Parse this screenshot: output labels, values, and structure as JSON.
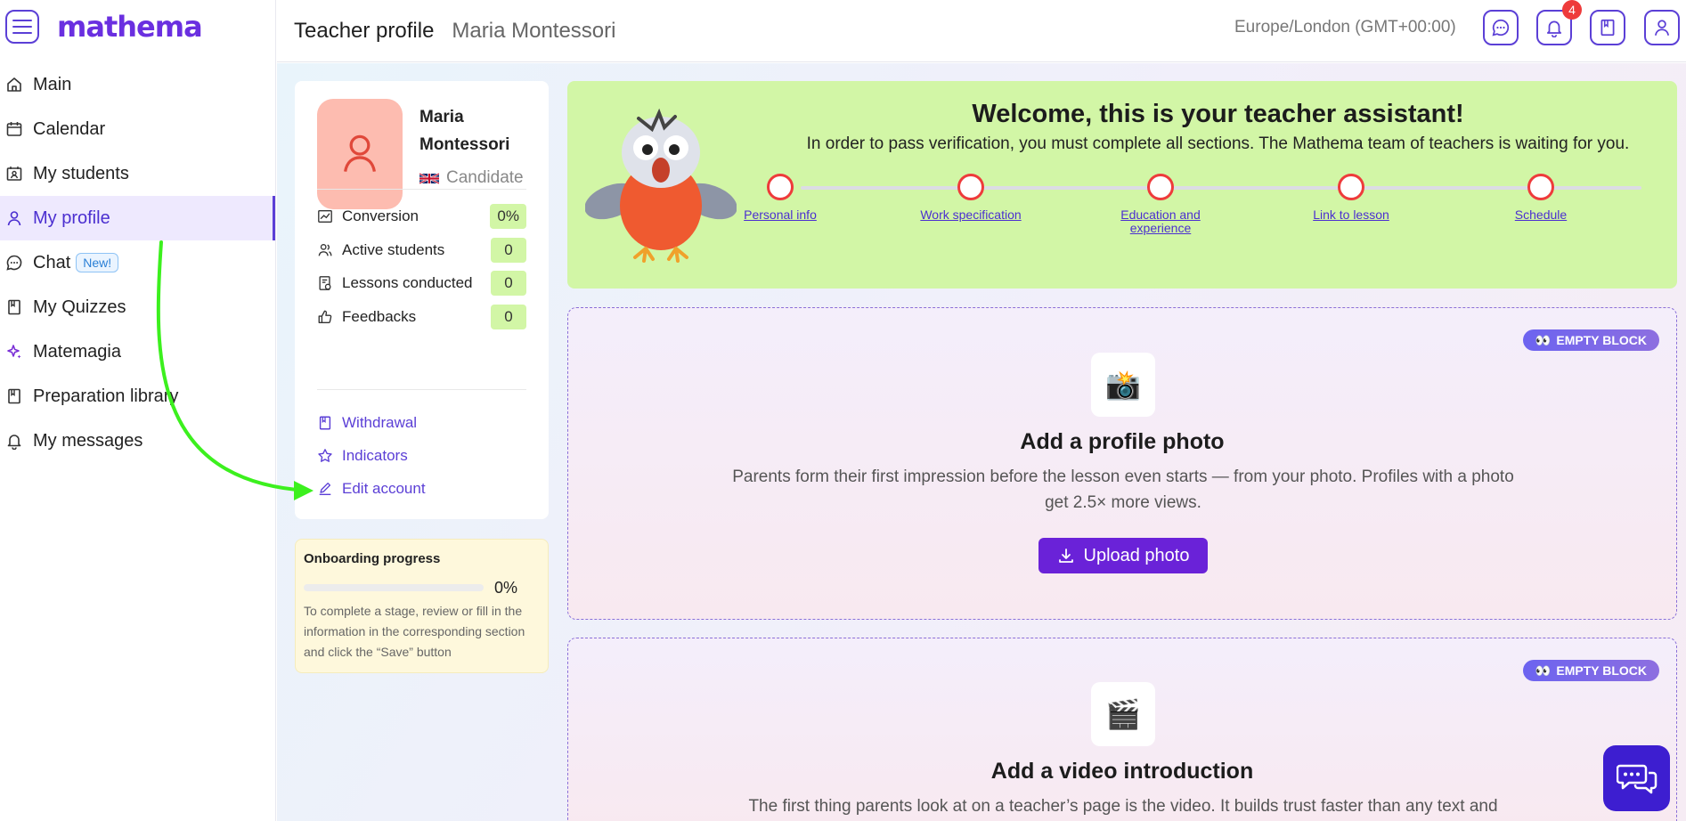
{
  "app": {
    "logo": "mathema"
  },
  "sidebar": {
    "items": [
      {
        "label": "Main",
        "icon": "home-icon"
      },
      {
        "label": "Calendar",
        "icon": "calendar-icon"
      },
      {
        "label": "My students",
        "icon": "students-icon"
      },
      {
        "label": "My profile",
        "icon": "user-icon",
        "active": true
      },
      {
        "label": "Chat",
        "icon": "chat-icon",
        "badge": "New!"
      },
      {
        "label": "My Quizzes",
        "icon": "book-icon"
      },
      {
        "label": "Matemagia",
        "icon": "sparkle-icon"
      },
      {
        "label": "Preparation library",
        "icon": "book-icon"
      },
      {
        "label": "My messages",
        "icon": "bell-icon"
      }
    ]
  },
  "header": {
    "title": "Teacher profile",
    "teacher_name": "Maria Montessori",
    "timezone": "Europe/London (GMT+00:00)",
    "notification_count": "4"
  },
  "profile": {
    "name": "Maria Montessori",
    "status": "Candidate",
    "stats": [
      {
        "label": "Conversion",
        "value": "0%"
      },
      {
        "label": "Active students",
        "value": "0"
      },
      {
        "label": "Lessons conducted",
        "value": "0"
      },
      {
        "label": "Feedbacks",
        "value": "0"
      }
    ],
    "links": [
      {
        "label": "Withdrawal"
      },
      {
        "label": "Indicators"
      },
      {
        "label": "Edit account"
      }
    ]
  },
  "onboarding": {
    "title": "Onboarding progress",
    "percent_text": "0%",
    "progress": 0,
    "description": "To complete a stage, review or fill in the information in the corresponding section and click the “Save” button"
  },
  "welcome": {
    "title": "Welcome, this is your teacher assistant!",
    "subtitle": "In order to pass verification, you must complete all sections. The Mathema team of teachers is waiting for you.",
    "steps": [
      {
        "label": "Personal info"
      },
      {
        "label": "Work specification"
      },
      {
        "label": "Education and experience"
      },
      {
        "label": "Link to lesson"
      },
      {
        "label": "Schedule"
      }
    ]
  },
  "blocks": [
    {
      "badge": "EMPTY BLOCK",
      "icon": "📸",
      "title": "Add a profile photo",
      "description": "Parents form their first impression before the lesson even starts — from your photo. Profiles with a photo get 2.5× more views.",
      "button": "Upload photo"
    },
    {
      "badge": "EMPTY BLOCK",
      "icon": "🎬",
      "title": "Add a video introduction",
      "description": "The first thing parents look at on a teacher’s page is the video. It builds trust faster than any text and"
    }
  ],
  "colors": {
    "accent": "#5b3fd6",
    "welcome_bg": "#d2f6a6",
    "stat_bg": "#d2f6a6",
    "step_circle": "#ee3b3b",
    "annotation": "#3cf01e"
  }
}
